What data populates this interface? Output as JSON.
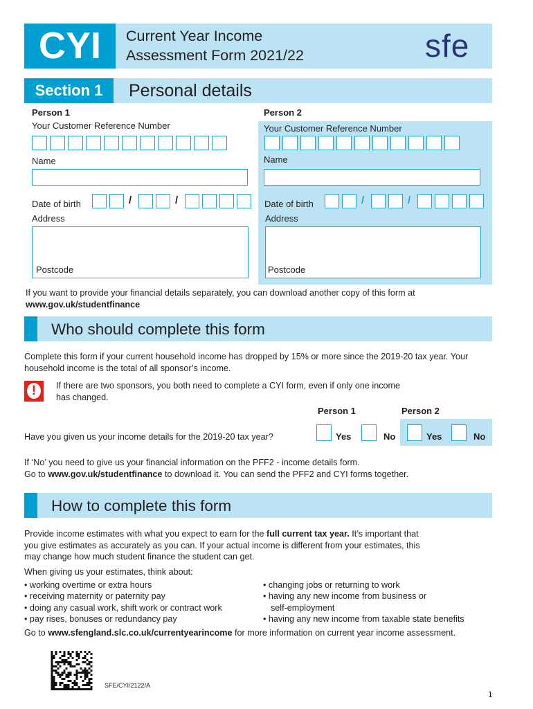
{
  "header": {
    "form_code": "CYI",
    "title_line1": "Current Year Income",
    "title_line2": "Assessment Form 2021/22",
    "brand_logo": "sfe"
  },
  "section1": {
    "label": "Section 1",
    "title": "Personal details",
    "person1": {
      "heading": "Person 1",
      "crn_label": "Your Customer Reference Number",
      "crn_boxes": 11,
      "name_label": "Name",
      "name_value": "",
      "dob_label": "Date of birth",
      "dob_separator": "/",
      "address_label": "Address",
      "postcode_label": "Postcode"
    },
    "person2": {
      "heading": "Person 2",
      "crn_label": "Your Customer Reference Number",
      "crn_boxes": 11,
      "name_label": "Name",
      "name_value": "",
      "dob_label": "Date of birth",
      "dob_separator": "/",
      "address_label": "Address",
      "postcode_label": "Postcode"
    },
    "separate_note": "If you want to provide your financial details separately, you can download another copy of this form at",
    "separate_link": "www.gov.uk/studentfinance"
  },
  "who_section": {
    "title": "Who should complete this form",
    "intro": "Complete this form if your current household income has dropped by 15% or more since the 2019-20 tax year. Your household income is the total of all sponsor’s income.",
    "warning_icon": "exclamation-warning-icon",
    "warning_text_line1": "If there are two sponsors, you both need to complete a CYI form, even if only one income",
    "warning_text_line2": "has changed.",
    "person1_label": "Person 1",
    "person2_label": "Person 2",
    "question": "Have you given us your income details for the 2019-20 tax year?",
    "yes_label": "Yes",
    "no_label": "No",
    "if_no_line1": "If ‘No’ you need to give us your financial information on the PFF2 - income details form.",
    "if_no_go_to": "Go to",
    "if_no_link": "www.gov.uk/studentfinance",
    "if_no_rest": "to download it. You can send the PFF2 and CYI forms together."
  },
  "how_section": {
    "title": "How to complete this form",
    "para_a": "Provide income estimates with what you expect to earn for the",
    "para_bold": "full current tax year.",
    "para_b": "It’s important that",
    "para_line2": "you give estimates as accurately as you can. If your actual income is different from your estimates, this",
    "para_line3": "may change how much student finance the student can get.",
    "think_about": "When giving us your estimates, think about:",
    "bullets_left": [
      "• working overtime or extra hours",
      "• receiving maternity or paternity pay",
      "• doing any casual work, shift work or contract work",
      "• pay rises, bonuses or redundancy pay"
    ],
    "bullets_right": [
      "• changing jobs or returning to work",
      "• having any new income from business or",
      "self-employment",
      "• having any new income from taxable state benefits"
    ],
    "goto_a": "Go to",
    "goto_link": "www.sfengland.slc.co.uk/currentyearincome",
    "goto_b": "for more information on current year income assessment."
  },
  "footer": {
    "barcode_icon": "datamatrix-barcode-icon",
    "form_reference": "SFE/CYI/2122/A",
    "page_number": "1"
  },
  "colors": {
    "accent_blue": "#00a0d2",
    "light_blue_band": "#bce3f3",
    "box_border": "#1fa6d4",
    "warning_red": "#e2231a",
    "logo_navy": "#2a3374"
  }
}
